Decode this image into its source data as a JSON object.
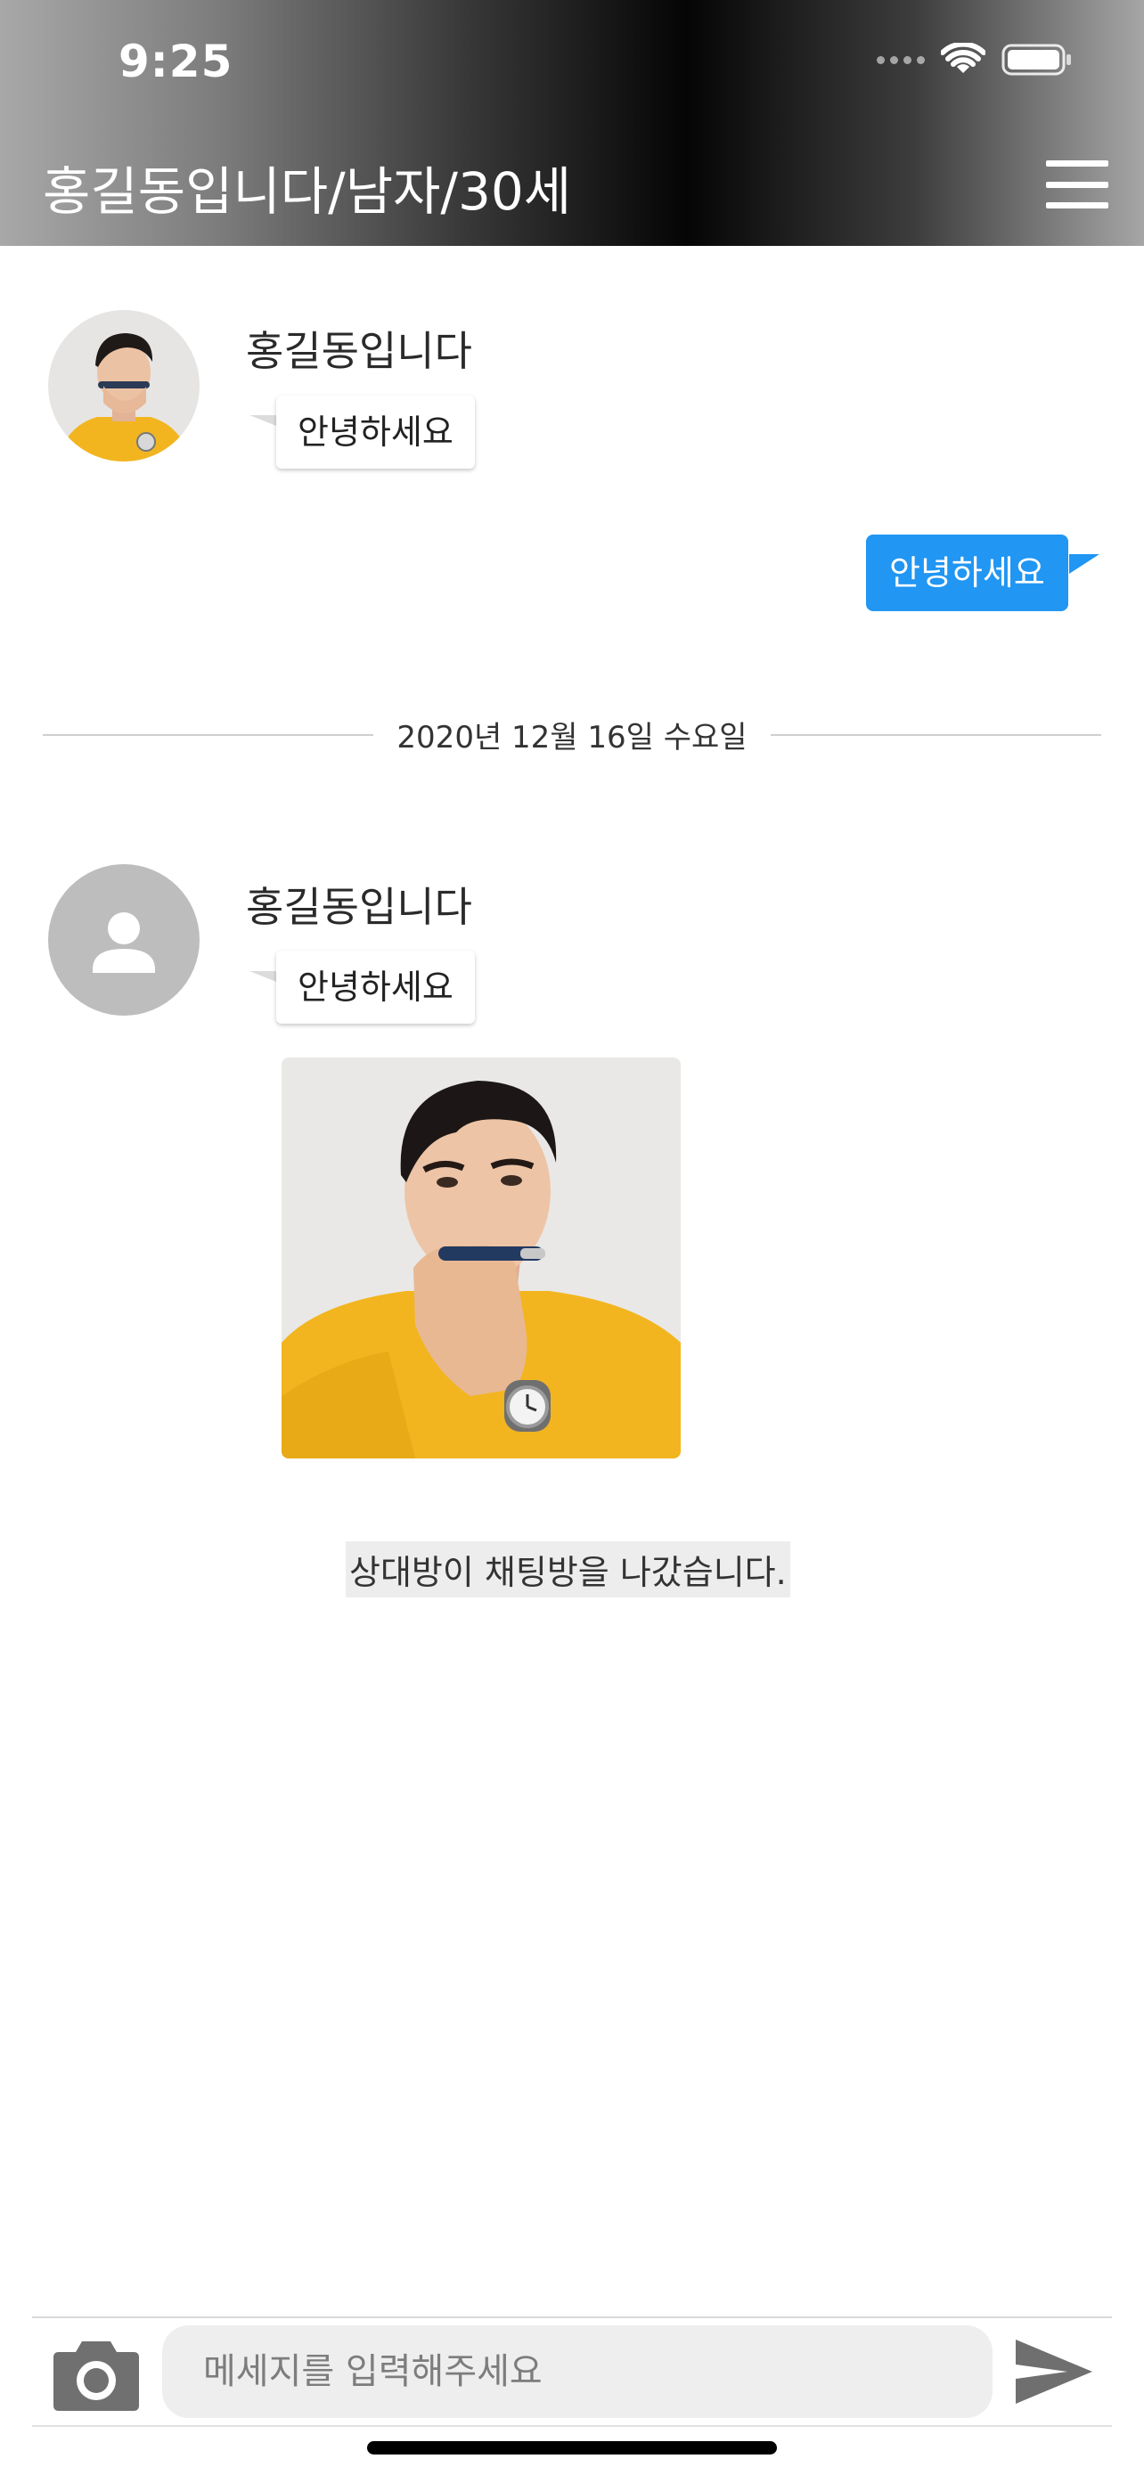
{
  "status_bar": {
    "time": "9:25"
  },
  "header": {
    "title": "홍길동입니다/남자/30세"
  },
  "messages": [
    {
      "sender": "홍길동입니다",
      "text": "안녕하세요"
    },
    {
      "text": "안녕하세요"
    }
  ],
  "date_divider": "2020년 12월 16일 수요일",
  "messages_after": [
    {
      "sender": "홍길동입니다",
      "text": "안녕하세요"
    }
  ],
  "system_notice": "상대방이 채팅방을 나갔습니다.",
  "composer": {
    "placeholder": "메세지를 입력해주세요",
    "value": ""
  },
  "colors": {
    "outgoing_bubble": "#2196F3",
    "sweater": "#F2B51F",
    "input_background": "#EEEEEE"
  },
  "icons": {
    "menu": "hamburger-icon",
    "camera": "camera-icon",
    "send": "send-icon",
    "default_avatar": "person-icon"
  }
}
